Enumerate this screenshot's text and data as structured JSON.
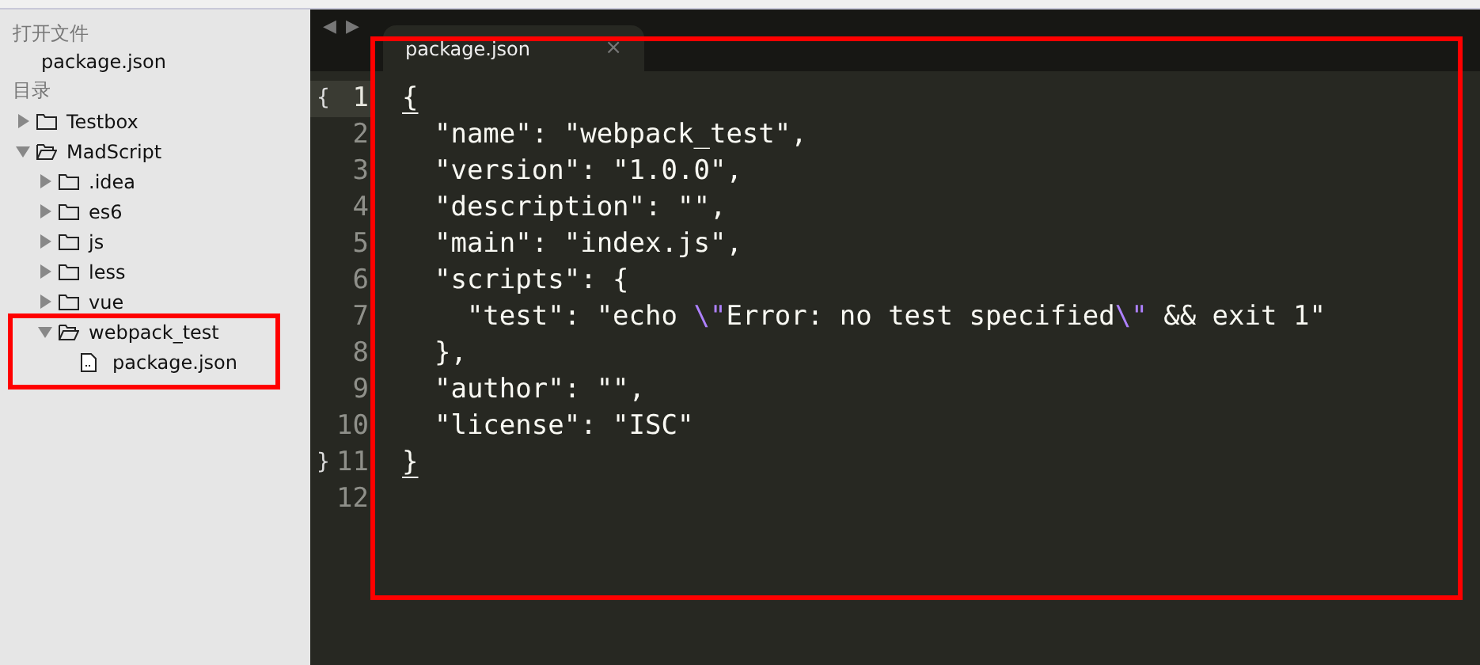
{
  "sidebar": {
    "open_files_title": "打开文件",
    "open_files": [
      {
        "label": "package.json"
      }
    ],
    "folders_title": "目录",
    "tree": [
      {
        "label": "Testbox",
        "kind": "folder",
        "expanded": false
      },
      {
        "label": "MadScript",
        "kind": "folder",
        "expanded": true,
        "children": [
          {
            "label": ".idea",
            "kind": "folder",
            "expanded": false
          },
          {
            "label": "es6",
            "kind": "folder",
            "expanded": false
          },
          {
            "label": "js",
            "kind": "folder",
            "expanded": false
          },
          {
            "label": "less",
            "kind": "folder",
            "expanded": false
          },
          {
            "label": "vue",
            "kind": "folder",
            "expanded": false
          },
          {
            "label": "webpack_test",
            "kind": "folder",
            "expanded": true,
            "highlighted": true,
            "children": [
              {
                "label": "package.json",
                "kind": "file"
              }
            ]
          }
        ]
      }
    ]
  },
  "tab_bar": {
    "nav": [
      "◀",
      "▶"
    ],
    "tabs": [
      {
        "label": "package.json",
        "close": "×",
        "selected": true
      }
    ]
  },
  "editor": {
    "highlighted": true,
    "lines": [
      {
        "number": "1",
        "fold": "{",
        "current": true,
        "segments": [
          {
            "text": "{",
            "kind": "bracket"
          }
        ]
      },
      {
        "number": "2",
        "current": false,
        "segments": [
          {
            "text": "  \"name\": \"webpack_test\",",
            "kind": "plain"
          }
        ]
      },
      {
        "number": "3",
        "current": false,
        "segments": [
          {
            "text": "  \"version\": \"1.0.0\",",
            "kind": "plain"
          }
        ]
      },
      {
        "number": "4",
        "current": false,
        "segments": [
          {
            "text": "  \"description\": \"\",",
            "kind": "plain"
          }
        ]
      },
      {
        "number": "5",
        "current": false,
        "segments": [
          {
            "text": "  \"main\": \"index.js\",",
            "kind": "plain"
          }
        ]
      },
      {
        "number": "6",
        "current": false,
        "segments": [
          {
            "text": "  \"scripts\": {",
            "kind": "plain"
          }
        ]
      },
      {
        "number": "7",
        "current": false,
        "segments": [
          {
            "text": "    \"test\": \"echo ",
            "kind": "plain"
          },
          {
            "text": "\\\"",
            "kind": "escape"
          },
          {
            "text": "Error: no test specified",
            "kind": "plain"
          },
          {
            "text": "\\\"",
            "kind": "escape"
          },
          {
            "text": " && exit 1\"",
            "kind": "plain"
          }
        ]
      },
      {
        "number": "8",
        "current": false,
        "segments": [
          {
            "text": "  },",
            "kind": "plain"
          }
        ]
      },
      {
        "number": "9",
        "current": false,
        "segments": [
          {
            "text": "  \"author\": \"\",",
            "kind": "plain"
          }
        ]
      },
      {
        "number": "10",
        "current": false,
        "segments": [
          {
            "text": "  \"license\": \"ISC\"",
            "kind": "plain"
          }
        ]
      },
      {
        "number": "11",
        "fold": "}",
        "current": false,
        "segments": [
          {
            "text": "}",
            "kind": "bracket"
          }
        ]
      },
      {
        "number": "12",
        "current": false
      }
    ]
  }
}
